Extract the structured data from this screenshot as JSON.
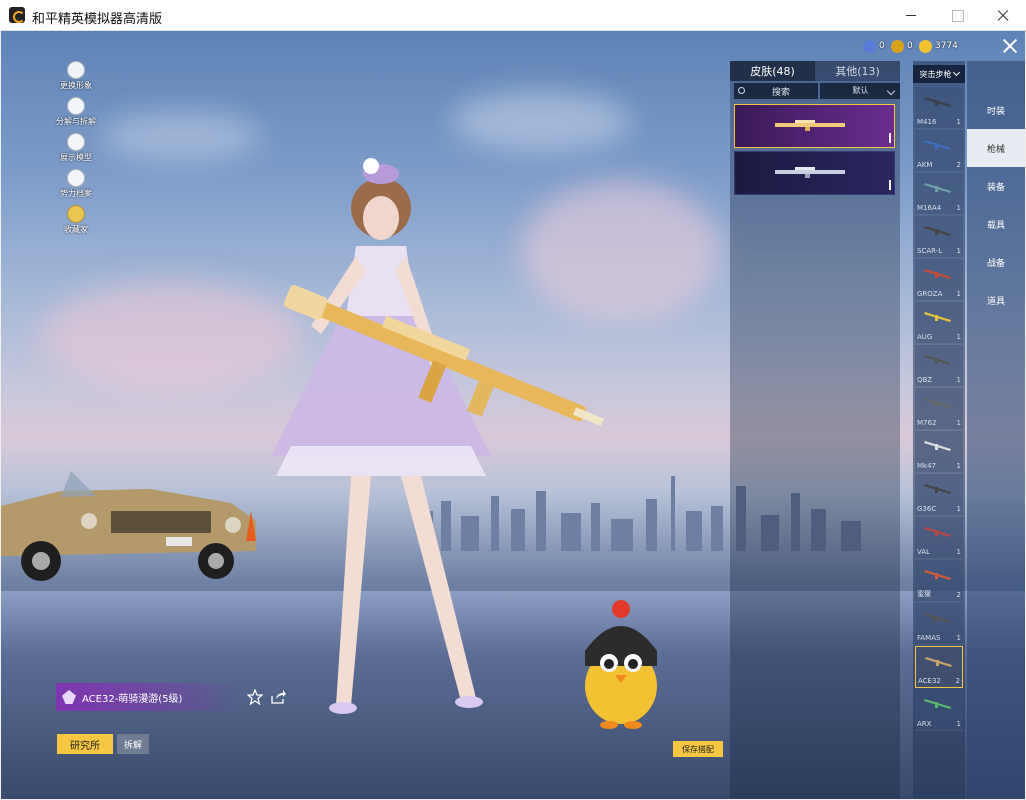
{
  "window": {
    "title": "和平精英模拟器高清版"
  },
  "side_menu": [
    {
      "label": "更换形象",
      "icon": "person-icon"
    },
    {
      "label": "分解与拆解",
      "icon": "puzzle-icon"
    },
    {
      "label": "展示模型",
      "icon": "eye-icon"
    },
    {
      "label": "势力档案",
      "icon": "shield-icon"
    },
    {
      "label": "收藏家",
      "icon": "collector-crown-icon"
    }
  ],
  "currencies": [
    {
      "value": "0",
      "icon": "globe-coin-icon",
      "color": "#5b7bd8"
    },
    {
      "value": "0",
      "icon": "medal-coin-icon",
      "color": "#d9a21d"
    },
    {
      "value": "3774",
      "icon": "shield-coin-icon",
      "color": "#f2c230"
    }
  ],
  "skin_panel": {
    "tabs": [
      {
        "label": "皮肤(48)"
      },
      {
        "label": "其他(13)"
      }
    ],
    "search_label": "搜索",
    "sort_label": "默认"
  },
  "weapon_panel": {
    "type_label": "突击步枪",
    "items": [
      {
        "name": "M416",
        "count": "1"
      },
      {
        "name": "AKM",
        "count": "2"
      },
      {
        "name": "M16A4",
        "count": "1"
      },
      {
        "name": "SCAR-L",
        "count": "1"
      },
      {
        "name": "GROZA",
        "count": "1"
      },
      {
        "name": "AUG",
        "count": "1"
      },
      {
        "name": "QBZ",
        "count": "1"
      },
      {
        "name": "M762",
        "count": "1"
      },
      {
        "name": "Mk47",
        "count": "1"
      },
      {
        "name": "G36C",
        "count": "1"
      },
      {
        "name": "VAL",
        "count": "1"
      },
      {
        "name": "蜜獾",
        "count": "2"
      },
      {
        "name": "FAMAS",
        "count": "1"
      },
      {
        "name": "ACE32",
        "count": "2"
      },
      {
        "name": "ARX",
        "count": "1"
      }
    ]
  },
  "categories": [
    {
      "label": "时装"
    },
    {
      "label": "枪械"
    },
    {
      "label": "装备"
    },
    {
      "label": "载具"
    },
    {
      "label": "战备"
    },
    {
      "label": "道具"
    }
  ],
  "selected_skin": {
    "name": "ACE32-萌骑漫游(5级)"
  },
  "buttons": {
    "research": "研究所",
    "dismantle": "拆解",
    "save_outfit": "保存搭配"
  },
  "colors": {
    "accent_yellow": "#f6c842",
    "legend_purple": "#8a3cc0"
  }
}
